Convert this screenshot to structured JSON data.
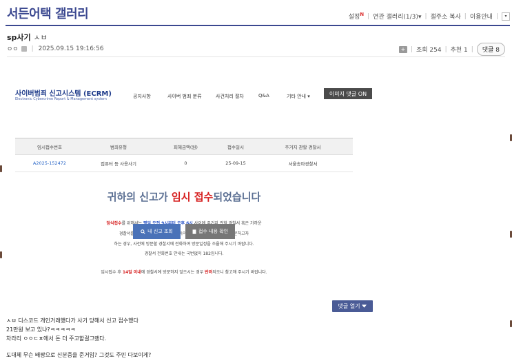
{
  "gallery": {
    "title": "서든어택 갤러리",
    "links": {
      "settings": "설정",
      "new_mark": "N",
      "related": "연관 갤러리(1/3)",
      "related_arrow": "▾",
      "copy_address": "갤주소 복사",
      "help": "이용안내",
      "dropdown": "▾"
    }
  },
  "post": {
    "title": "sp사기",
    "title_sub": "ㅅㅂ",
    "author": "ㅇㅇ",
    "date": "2025.09.15 19:16:56",
    "views_label": "조회 254",
    "recommend_label": "추천 1",
    "comment_label": "댓글 8",
    "folder_icon_glyph": "+"
  },
  "ecrm": {
    "logo_title": "사이버범죄 신고시스템 (ECRM)",
    "logo_sub": "Electronic Cybercrime Report & Management system",
    "nav": [
      "공지사항",
      "사이버 범죄 분류",
      "사건처리 절차",
      "Q&A",
      "기타 안내  ▾"
    ],
    "image_comment_on": "이미지 댓글 ON",
    "table": {
      "headers": [
        "임시접수번호",
        "범죄유형",
        "피해금액(원)",
        "접수일시",
        "주거지 관할 경찰서"
      ],
      "row": [
        "A2025-152472",
        "컴퓨터 등 사용사기",
        "0",
        "25-09-15",
        "서울송파경찰서"
      ]
    },
    "headline_prefix": "귀하의 신고가 ",
    "headline_red": "임시 접수",
    "headline_suffix": "되었습니다",
    "p1_red": "정식접수",
    "p1_a": "를 위해서는 ",
    "p1_blue": "평일 오전 9시부터 오후 6시",
    "p1_b": " 사이에 주거지 관할 경찰서 혹은 가까운",
    "p2": "경찰서를 방문해 주시기 바라며, 부득이 일과시간 이외의 시간에 방문하고자",
    "p3": "하는 경우, 사전에 방문할 경찰서에 전화하여 방문일정을 조율해 주시기 바랍니다.",
    "p4": "경찰서 전화번호 안내는 국번없이 182입니다.",
    "p5_a": "임시접수 후 ",
    "p5_red1": "14일 이내",
    "p5_b": "에 경찰서에 방문하지 않으시는 경우 ",
    "p5_red2": "반려",
    "p5_c": "되오니 참고해 주시기 바랍니다.",
    "btn_check": "내 신고 조회",
    "btn_view": "접수 내용 확인"
  },
  "comment_toggle": "댓글 열기",
  "body_lines": [
    "ㅅㅂ 디스코드 개인거래했다가 사기 당해서 신고 접수했다",
    "21만원 보고 있냐?ㅋㅋㅋㅋㅋ",
    "차라리 ㅇㅇㄷㅍ에서 돈 더 주고할걸그랬다.",
    "도대체 무슨 배짱으로 신분증을 준거임? 그것도 주민 다보이게?"
  ]
}
